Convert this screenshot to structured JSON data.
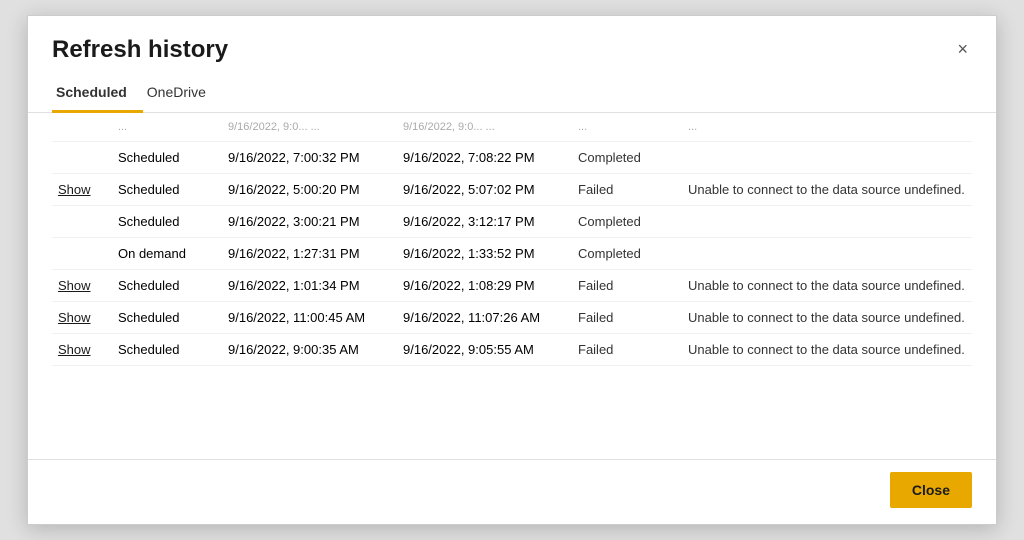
{
  "dialog": {
    "title": "Refresh history",
    "close_label": "×"
  },
  "tabs": [
    {
      "id": "scheduled",
      "label": "Scheduled",
      "active": true
    },
    {
      "id": "onedrive",
      "label": "OneDrive",
      "active": false
    }
  ],
  "table": {
    "rows": [
      {
        "show": "",
        "type": "...",
        "start": "...",
        "end": "...",
        "status": "...",
        "error": "...",
        "truncated": true
      },
      {
        "show": "",
        "type": "Scheduled",
        "start": "9/16/2022, 7:00:32 PM",
        "end": "9/16/2022, 7:08:22 PM",
        "status": "Completed",
        "error": "",
        "truncated": false
      },
      {
        "show": "Show",
        "type": "Scheduled",
        "start": "9/16/2022, 5:00:20 PM",
        "end": "9/16/2022, 5:07:02 PM",
        "status": "Failed",
        "error": "Unable to connect to the data source undefined.",
        "truncated": false
      },
      {
        "show": "",
        "type": "Scheduled",
        "start": "9/16/2022, 3:00:21 PM",
        "end": "9/16/2022, 3:12:17 PM",
        "status": "Completed",
        "error": "",
        "truncated": false
      },
      {
        "show": "",
        "type": "On demand",
        "start": "9/16/2022, 1:27:31 PM",
        "end": "9/16/2022, 1:33:52 PM",
        "status": "Completed",
        "error": "",
        "truncated": false
      },
      {
        "show": "Show",
        "type": "Scheduled",
        "start": "9/16/2022, 1:01:34 PM",
        "end": "9/16/2022, 1:08:29 PM",
        "status": "Failed",
        "error": "Unable to connect to the data source undefined.",
        "truncated": false
      },
      {
        "show": "Show",
        "type": "Scheduled",
        "start": "9/16/2022, 11:00:45 AM",
        "end": "9/16/2022, 11:07:26 AM",
        "status": "Failed",
        "error": "Unable to connect to the data source undefined.",
        "truncated": false
      },
      {
        "show": "Show",
        "type": "Scheduled",
        "start": "9/16/2022, 9:00:35 AM",
        "end": "9/16/2022, 9:05:55 AM",
        "status": "Failed",
        "error": "Unable to connect to the data source undefined.",
        "truncated": false
      }
    ]
  },
  "footer": {
    "close_label": "Close"
  }
}
